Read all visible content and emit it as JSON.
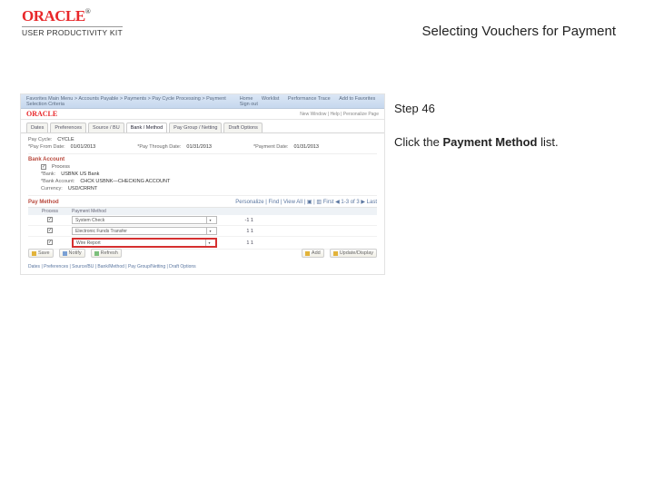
{
  "doc": {
    "brand": "ORACLE",
    "reg": "®",
    "kit": "USER PRODUCTIVITY KIT",
    "title": "Selecting Vouchers for Payment"
  },
  "step": {
    "label": "Step 46",
    "instr_pre": "Click the ",
    "instr_bold": "Payment Method",
    "instr_post": " list."
  },
  "app": {
    "hdr_left": "Favorites   Main Menu > Accounts Payable > Payments > Pay Cycle Processing > Payment Selection Criteria",
    "hdr_right": {
      "home": "Home",
      "worklist": "Worklist",
      "perf": "Performance Trace",
      "addfav": "Add to Favorites",
      "signout": "Sign out"
    },
    "brand": "ORACLE",
    "userline": "New Window | Help | Personalize Page",
    "tabs": [
      "Dates",
      "Preferences",
      "Source / BU",
      "Bank / Method",
      "Pay Group / Netting",
      "Draft Options"
    ],
    "active_tab_idx": 3,
    "fields": {
      "paycycle_lbl": "Pay Cycle:",
      "paycycle_val": "CYCLE",
      "from_lbl": "*Pay From Date:",
      "from_val": "01/01/2013",
      "thru_lbl": "*Pay Through Date:",
      "thru_val": "01/31/2013",
      "pmt_lbl": "*Payment Date:",
      "pmt_val": "01/31/2013"
    },
    "bank_section": "Bank Account",
    "bank_rows": {
      "process": "Process",
      "bank_lbl": "*Bank:",
      "bank_val": "USBNK  US Bank",
      "acct_lbl": "*Bank Account:",
      "acct_val": "CHCK  USBNK—CHECKING ACCOUNT",
      "curr_lbl": "Currency:",
      "curr_val": "USD/CRRNT"
    },
    "pm_section": "Pay Method",
    "pm_toolbar": "Personalize | Find | View All | ▣ | ▥   First ◀ 1-3 of 3 ▶ Last",
    "pm_head": {
      "process": "Process",
      "method": "Payment Method"
    },
    "pm_rows": [
      {
        "checked": true,
        "method": "System Check",
        "n": "-1   1"
      },
      {
        "checked": true,
        "method": "Electronic Funds Transfer",
        "n": "1   1"
      },
      {
        "checked": true,
        "method": "Wire Report",
        "n": "1   1",
        "hl": true
      }
    ],
    "footer_buttons": {
      "save": "Save",
      "notify": "Notify",
      "refresh": "Refresh",
      "add": "Add",
      "upd": "Update/Display"
    },
    "footer_links": "Dates | Preferences | Source/BU | Bank/Method | Pay Group/Netting | Draft Options"
  }
}
